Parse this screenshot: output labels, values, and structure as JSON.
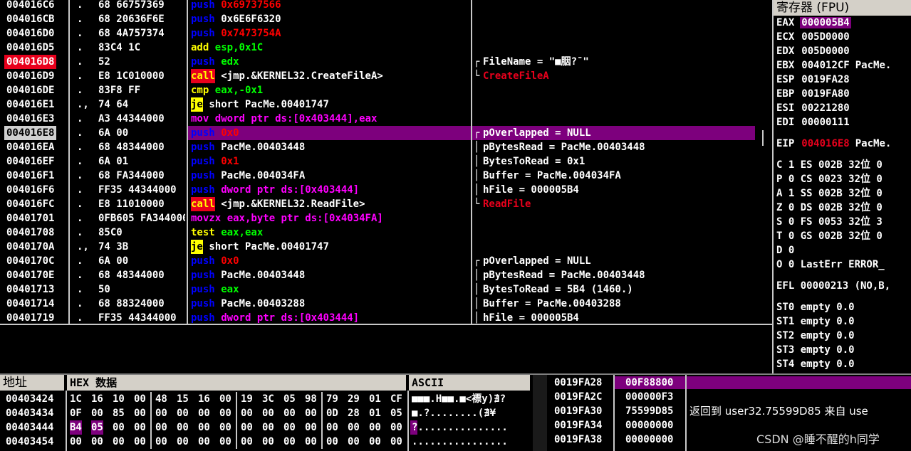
{
  "disasm": {
    "rows": [
      {
        "addr": "004016C6",
        "mark": ".",
        "hex": "68 66757369",
        "op": "push",
        "opnd": "0x69737566",
        "op_class": "kw-push",
        "opnd_class": "op-imm",
        "addr_style": ""
      },
      {
        "addr": "004016CB",
        "mark": ".",
        "hex": "68 20636F6E",
        "op": "push",
        "opnd": "0x6E6F6320",
        "op_class": "kw-push",
        "opnd_class": "op-sym",
        "addr_style": ""
      },
      {
        "addr": "004016D0",
        "mark": ".",
        "hex": "68 4A757374",
        "op": "push",
        "opnd": "0x7473754A",
        "op_class": "kw-push",
        "opnd_class": "op-imm",
        "addr_style": ""
      },
      {
        "addr": "004016D5",
        "mark": ".",
        "hex": "83C4 1C",
        "op": "add",
        "opnd": "esp,0x1C",
        "op_class": "kw-add",
        "opnd_class": "op-reg",
        "addr_style": ""
      },
      {
        "addr": "004016D8",
        "mark": ".",
        "hex": "52",
        "op": "push",
        "opnd": "edx",
        "op_class": "kw-push",
        "opnd_class": "op-reg",
        "addr_style": "addr-red"
      },
      {
        "addr": "004016D9",
        "mark": ".",
        "hex": "E8 1C010000",
        "op": "call",
        "opnd": "<jmp.&KERNEL32.CreateFileA>",
        "op_class": "kw-call",
        "opnd_class": "op-sym",
        "addr_style": ""
      },
      {
        "addr": "004016DE",
        "mark": ".",
        "hex": "83F8 FF",
        "op": "cmp",
        "opnd": "eax,-0x1",
        "op_class": "kw-cmp",
        "opnd_class": "op-reg",
        "addr_style": ""
      },
      {
        "addr": "004016E1",
        "mark": ".,",
        "hex": "74 64",
        "op": "je",
        "opnd": "short PacMe.00401747",
        "op_class": "kw-je",
        "opnd_class": "op-sym",
        "addr_style": ""
      },
      {
        "addr": "004016E3",
        "mark": ".",
        "hex": "A3 44344000",
        "op": "mov",
        "opnd": "dword ptr ds:[0x403444],eax",
        "op_class": "kw-mov",
        "opnd_class": "op-mem",
        "addr_style": ""
      },
      {
        "addr": "004016E8",
        "mark": ".",
        "hex": "6A 00",
        "op": "push",
        "opnd": "0x0",
        "op_class": "kw-push",
        "opnd_class": "op-imm",
        "addr_style": "addr-sel"
      },
      {
        "addr": "004016EA",
        "mark": ".",
        "hex": "68 48344000",
        "op": "push",
        "opnd": "PacMe.00403448",
        "op_class": "kw-push",
        "opnd_class": "op-sym",
        "addr_style": ""
      },
      {
        "addr": "004016EF",
        "mark": ".",
        "hex": "6A 01",
        "op": "push",
        "opnd": "0x1",
        "op_class": "kw-push",
        "opnd_class": "op-imm",
        "addr_style": ""
      },
      {
        "addr": "004016F1",
        "mark": ".",
        "hex": "68 FA344000",
        "op": "push",
        "opnd": "PacMe.004034FA",
        "op_class": "kw-push",
        "opnd_class": "op-sym",
        "addr_style": ""
      },
      {
        "addr": "004016F6",
        "mark": ".",
        "hex": "FF35 44344000",
        "op": "push",
        "opnd": "dword ptr ds:[0x403444]",
        "op_class": "kw-push",
        "opnd_class": "op-mem",
        "addr_style": ""
      },
      {
        "addr": "004016FC",
        "mark": ".",
        "hex": "E8 11010000",
        "op": "call",
        "opnd": "<jmp.&KERNEL32.ReadFile>",
        "op_class": "kw-call",
        "opnd_class": "op-sym",
        "addr_style": ""
      },
      {
        "addr": "00401701",
        "mark": ".",
        "hex": "0FB605 FA344000",
        "op": "movzx",
        "opnd": "eax,byte ptr ds:[0x4034FA]",
        "op_class": "kw-mov",
        "opnd_class": "op-mem",
        "addr_style": ""
      },
      {
        "addr": "00401708",
        "mark": ".",
        "hex": "85C0",
        "op": "test",
        "opnd": "eax,eax",
        "op_class": "kw-test",
        "opnd_class": "op-reg",
        "addr_style": ""
      },
      {
        "addr": "0040170A",
        "mark": ".,",
        "hex": "74 3B",
        "op": "je",
        "opnd": "short PacMe.00401747",
        "op_class": "kw-je",
        "opnd_class": "op-sym",
        "addr_style": ""
      },
      {
        "addr": "0040170C",
        "mark": ".",
        "hex": "6A 00",
        "op": "push",
        "opnd": "0x0",
        "op_class": "kw-push",
        "opnd_class": "op-imm",
        "addr_style": ""
      },
      {
        "addr": "0040170E",
        "mark": ".",
        "hex": "68 48344000",
        "op": "push",
        "opnd": "PacMe.00403448",
        "op_class": "kw-push",
        "opnd_class": "op-sym",
        "addr_style": ""
      },
      {
        "addr": "00401713",
        "mark": ".",
        "hex": "50",
        "op": "push",
        "opnd": "eax",
        "op_class": "kw-push",
        "opnd_class": "op-reg",
        "addr_style": ""
      },
      {
        "addr": "00401714",
        "mark": ".",
        "hex": "68 88324000",
        "op": "push",
        "opnd": "PacMe.00403288",
        "op_class": "kw-push",
        "opnd_class": "op-sym",
        "addr_style": ""
      },
      {
        "addr": "00401719",
        "mark": ".",
        "hex": "FF35 44344000",
        "op": "push",
        "opnd": "dword ptr ds:[0x403444]",
        "op_class": "kw-push",
        "opnd_class": "op-mem",
        "addr_style": ""
      }
    ],
    "comments": [
      {
        "row": 4,
        "text": "FileName = \"■胭?¯\"",
        "cls": "",
        "bracket": "┌"
      },
      {
        "row": 5,
        "text": "CreateFileA",
        "cls": "c-red",
        "bracket": "└"
      },
      {
        "row": 9,
        "text": "pOverlapped = NULL",
        "cls": "",
        "bracket": "┌"
      },
      {
        "row": 10,
        "text": "pBytesRead = PacMe.00403448",
        "cls": "",
        "bracket": "│"
      },
      {
        "row": 11,
        "text": "BytesToRead = 0x1",
        "cls": "",
        "bracket": "│"
      },
      {
        "row": 12,
        "text": "Buffer = PacMe.004034FA",
        "cls": "",
        "bracket": "│"
      },
      {
        "row": 13,
        "text": "hFile = 000005B4",
        "cls": "",
        "bracket": "│"
      },
      {
        "row": 14,
        "text": "ReadFile",
        "cls": "c-red",
        "bracket": "└"
      },
      {
        "row": 18,
        "text": "pOverlapped = NULL",
        "cls": "",
        "bracket": "┌"
      },
      {
        "row": 19,
        "text": "pBytesRead = PacMe.00403448",
        "cls": "",
        "bracket": "│"
      },
      {
        "row": 20,
        "text": "BytesToRead = 5B4 (1460.)",
        "cls": "",
        "bracket": "│"
      },
      {
        "row": 21,
        "text": "Buffer = PacMe.00403288",
        "cls": "",
        "bracket": "│"
      },
      {
        "row": 22,
        "text": "hFile = 000005B4",
        "cls": "",
        "bracket": "│"
      }
    ]
  },
  "registers": {
    "header": "寄存器 (FPU)",
    "gp": [
      {
        "name": "EAX",
        "val": "000005B4",
        "extra": ""
      },
      {
        "name": "ECX",
        "val": "005D0000",
        "extra": ""
      },
      {
        "name": "EDX",
        "val": "005D0000",
        "extra": ""
      },
      {
        "name": "EBX",
        "val": "004012CF",
        "extra": "PacMe."
      },
      {
        "name": "ESP",
        "val": "0019FA28",
        "extra": ""
      },
      {
        "name": "EBP",
        "val": "0019FA80",
        "extra": ""
      },
      {
        "name": "ESI",
        "val": "00221280",
        "extra": ""
      },
      {
        "name": "EDI",
        "val": "00000111",
        "extra": ""
      }
    ],
    "eip": {
      "name": "EIP",
      "val": "004016E8",
      "extra": "PacMe."
    },
    "flags": [
      {
        "f": "C",
        "v": "1",
        "seg": "ES",
        "sv": "002B",
        "bits": "32位",
        "tail": "0"
      },
      {
        "f": "P",
        "v": "0",
        "seg": "CS",
        "sv": "0023",
        "bits": "32位",
        "tail": "0"
      },
      {
        "f": "A",
        "v": "1",
        "seg": "SS",
        "sv": "002B",
        "bits": "32位",
        "tail": "0"
      },
      {
        "f": "Z",
        "v": "0",
        "seg": "DS",
        "sv": "002B",
        "bits": "32位",
        "tail": "0"
      },
      {
        "f": "S",
        "v": "0",
        "seg": "FS",
        "sv": "0053",
        "bits": "32位",
        "tail": "3"
      },
      {
        "f": "T",
        "v": "0",
        "seg": "GS",
        "sv": "002B",
        "bits": "32位",
        "tail": "0"
      },
      {
        "f": "D",
        "v": "0",
        "seg": "",
        "sv": "",
        "bits": "",
        "tail": ""
      },
      {
        "f": "O",
        "v": "0",
        "seg": "LastErr",
        "sv": "ERROR_",
        "bits": "",
        "tail": ""
      }
    ],
    "efl": "EFL 00000213 (NO,B,",
    "fpu": [
      "ST0 empty 0.0",
      "ST1 empty 0.0",
      "ST2 empty 0.0",
      "ST3 empty 0.0",
      "ST4 empty 0.0"
    ]
  },
  "dump": {
    "col_addr": "地址",
    "col_hex": "HEX 数据",
    "col_ascii": "ASCII",
    "rows": [
      {
        "addr": "00403424",
        "bytes": [
          "1C",
          "16",
          "10",
          "00",
          "48",
          "15",
          "16",
          "00",
          "19",
          "3C",
          "05",
          "98",
          "79",
          "29",
          "01",
          "CF"
        ],
        "ascii": "■■■.H■■.■<褾y)∄?"
      },
      {
        "addr": "00403434",
        "bytes": [
          "0F",
          "00",
          "85",
          "00",
          "00",
          "00",
          "00",
          "00",
          "00",
          "00",
          "00",
          "00",
          "0D",
          "28",
          "01",
          "05"
        ],
        "ascii": "■.?........(∄¥"
      },
      {
        "addr": "00403444",
        "bytes": [
          "B4",
          "05",
          "00",
          "00",
          "00",
          "00",
          "00",
          "00",
          "00",
          "00",
          "00",
          "00",
          "00",
          "00",
          "00",
          "00"
        ],
        "ascii": "?..............."
      },
      {
        "addr": "00403454",
        "bytes": [
          "00",
          "00",
          "00",
          "00",
          "00",
          "00",
          "00",
          "00",
          "00",
          "00",
          "00",
          "00",
          "00",
          "00",
          "00",
          "00"
        ],
        "ascii": "................"
      }
    ]
  },
  "stack": {
    "rows": [
      {
        "addr": "0019FA28",
        "val": "00F88800",
        "comment": ""
      },
      {
        "addr": "0019FA2C",
        "val": "000000F3",
        "comment": ""
      },
      {
        "addr": "0019FA30",
        "val": "75599D85",
        "comment": "返回到 user32.75599D85 来自 use"
      },
      {
        "addr": "0019FA34",
        "val": "00000000",
        "comment": ""
      },
      {
        "addr": "0019FA38",
        "val": "00000000",
        "comment": ""
      }
    ]
  },
  "watermark": "CSDN @睡不醒的h同学"
}
